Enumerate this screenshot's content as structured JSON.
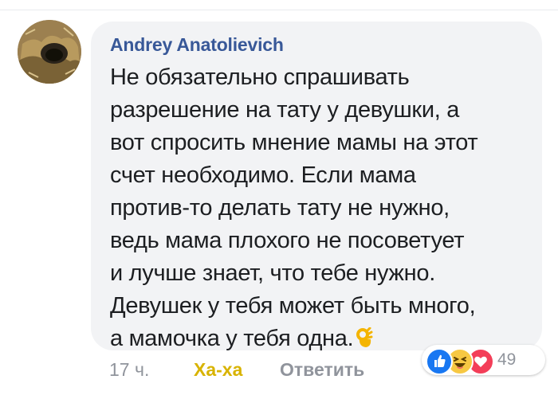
{
  "comment": {
    "author": "Andrey Anatolievich",
    "text_lines": [
      "Не обязательно спрашивать",
      "разрешение на тату у девушки, а",
      "вот спросить мнение мамы на этот",
      "счет необходимо. Если мама",
      "против-то делать тату не нужно,",
      "ведь мама плохого не посоветует",
      "и лучше знает, что тебе нужно.",
      "Девушек у тебя может быть много,",
      "а мамочка у тебя одна."
    ],
    "emoji": "ok-hand-icon"
  },
  "actions": {
    "time": "17 ч.",
    "reaction_label": "Ха-ха",
    "reply_label": "Ответить"
  },
  "reactions": {
    "icons": [
      "like-icon",
      "haha-icon",
      "love-icon"
    ],
    "count": "49"
  },
  "colors": {
    "author": "#385898",
    "bubble": "#f2f3f5",
    "haha_active": "#d8b300",
    "meta": "#90949c",
    "like": "#1877f2",
    "haha": "#f7c843",
    "love": "#f33e58"
  }
}
